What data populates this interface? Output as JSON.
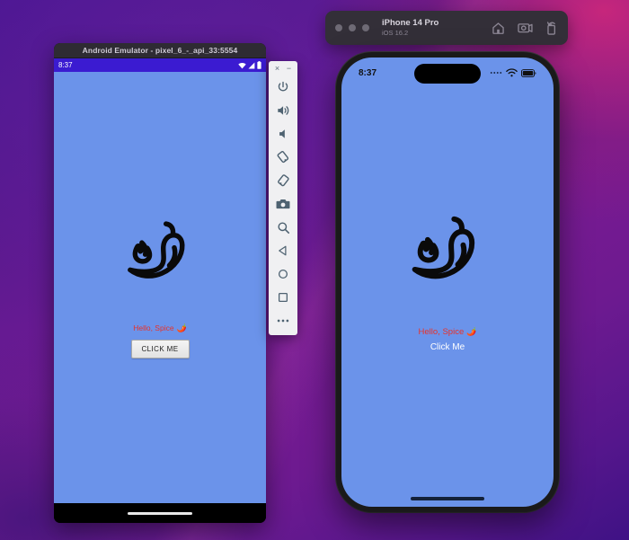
{
  "wallpaper": {
    "colors": [
      "#4b1694",
      "#7a1b92",
      "#d62878",
      "#3f1285"
    ]
  },
  "android_window": {
    "title": "Android Emulator - pixel_6_-_api_33:5554",
    "status_bar": {
      "clock": "8:37",
      "icons": [
        "wifi-icon",
        "cellular-signal-icon",
        "battery-icon"
      ]
    },
    "app": {
      "logo_name": "chili-pepper-logo",
      "hello_text": "Hello, Spice",
      "hello_emoji": "🌶️",
      "hello_color": "#e8322a",
      "button_label": "CLICK ME",
      "background_color": "#6b93ea"
    },
    "nav_bar": {
      "gesture_pill": "gesture-pill"
    }
  },
  "emulator_toolbar": {
    "window_buttons": {
      "close": "×",
      "minimize": "−"
    },
    "controls": [
      {
        "name": "power-icon",
        "label": "Power"
      },
      {
        "name": "volume-up-icon",
        "label": "Volume Up"
      },
      {
        "name": "volume-down-icon",
        "label": "Volume Down"
      },
      {
        "name": "rotate-left-icon",
        "label": "Rotate Left"
      },
      {
        "name": "rotate-right-icon",
        "label": "Rotate Right"
      },
      {
        "name": "screenshot-camera-icon",
        "label": "Take Screenshot"
      },
      {
        "name": "zoom-icon",
        "label": "Enter Zoom Mode"
      },
      {
        "name": "back-triangle-icon",
        "label": "Back"
      },
      {
        "name": "home-circle-icon",
        "label": "Home"
      },
      {
        "name": "overview-square-icon",
        "label": "Overview"
      },
      {
        "name": "more-ellipsis-icon",
        "label": "More"
      }
    ]
  },
  "ios_simulator": {
    "titlebar": {
      "device_name": "iPhone 14 Pro",
      "os_version": "iOS 16.2",
      "traffic_lights": 3,
      "icons": [
        {
          "name": "home-icon",
          "label": "Home"
        },
        {
          "name": "screenshot-icon",
          "label": "Screenshot"
        },
        {
          "name": "rotate-icon",
          "label": "Rotate"
        }
      ]
    },
    "status_bar": {
      "clock": "8:37",
      "icons": [
        "cellular-dots-icon",
        "wifi-icon",
        "battery-icon"
      ]
    },
    "app": {
      "logo_name": "chili-pepper-logo",
      "hello_text": "Hello, Spice",
      "hello_emoji": "🌶️",
      "hello_color": "#e8322a",
      "button_label": "Click Me",
      "background_color": "#6b93ea"
    }
  }
}
